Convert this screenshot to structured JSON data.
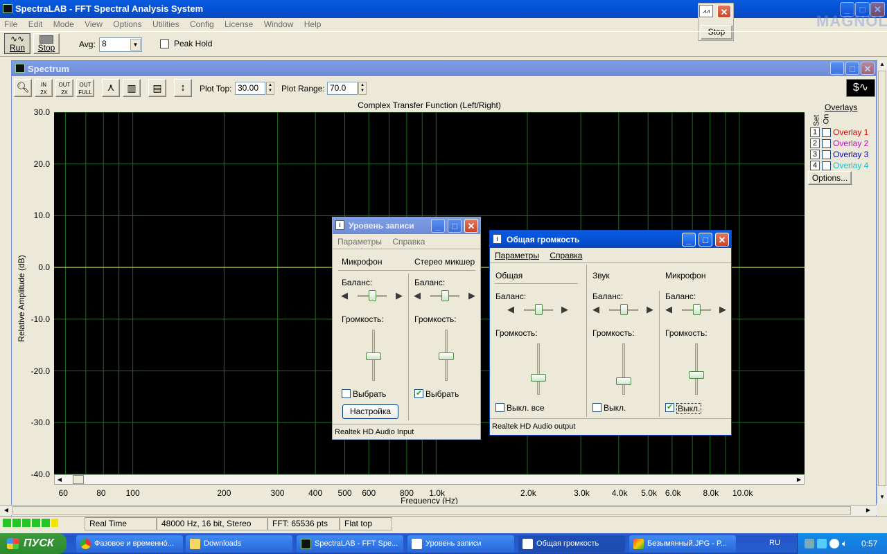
{
  "app": {
    "title": "SpectraLAB - FFT Spectral Analysis System",
    "menu": [
      "File",
      "Edit",
      "Mode",
      "View",
      "Options",
      "Utilities",
      "Config",
      "License",
      "Window",
      "Help"
    ]
  },
  "toolbar": {
    "run_label": "Run",
    "stop_label": "Stop",
    "avg_label": "Avg:",
    "avg_value": "8",
    "peak_hold_label": "Peak Hold"
  },
  "mini": {
    "stop_label": "Stop"
  },
  "watermark": "MAGNOLIA",
  "spectrum": {
    "title": "Spectrum",
    "plot_top_label": "Plot Top:",
    "plot_top_value": "30.00",
    "plot_range_label": "Plot Range:",
    "plot_range_value": "70.0",
    "chart_title": "Complex Transfer Function (Left/Right)",
    "y_axis_label": "Relative Amplitude (dB)",
    "x_axis_label": "Frequency (Hz)",
    "y_ticks": [
      "30.0",
      "20.0",
      "10.0",
      "0.0",
      "-10.0",
      "-20.0",
      "-30.0",
      "-40.0"
    ],
    "x_ticks": [
      "60",
      "80",
      "100",
      "200",
      "300",
      "400",
      "500",
      "600",
      "800",
      "1.0k",
      "2.0k",
      "3.0k",
      "4.0k",
      "5.0k",
      "6.0k",
      "8.0k",
      "10.0k"
    ]
  },
  "overlays": {
    "title": "Overlays",
    "set_label": "Set",
    "on_label": "On",
    "items": [
      {
        "num": "1",
        "label": "Overlay 1",
        "color": "#e00000"
      },
      {
        "num": "2",
        "label": "Overlay 2",
        "color": "#d000d0"
      },
      {
        "num": "3",
        "label": "Overlay 3",
        "color": "#0000d0"
      },
      {
        "num": "4",
        "label": "Overlay 4",
        "color": "#00c8d8"
      }
    ],
    "options_label": "Options..."
  },
  "rec_window": {
    "title": "Уровень записи",
    "menu": [
      "Параметры",
      "Справка"
    ],
    "col1": {
      "name": "Микрофон",
      "balance": "Баланс:",
      "volume": "Громкость:",
      "check": "Выбрать",
      "checked": false,
      "button": "Настройка"
    },
    "col2": {
      "name": "Стерео микшер",
      "balance": "Баланс:",
      "volume": "Громкость:",
      "check": "Выбрать",
      "checked": true
    },
    "status": "Realtek HD Audio Input"
  },
  "vol_window": {
    "title": "Общая громкость",
    "menu": [
      "Параметры",
      "Справка"
    ],
    "col1": {
      "name": "Общая",
      "balance": "Баланс:",
      "volume": "Громкость:",
      "check": "Выкл. все",
      "checked": false
    },
    "col2": {
      "name": "Звук",
      "balance": "Баланс:",
      "volume": "Громкость:",
      "check": "Выкл.",
      "checked": false
    },
    "col3": {
      "name": "Микрофон",
      "balance": "Баланс:",
      "volume": "Громкость:",
      "check": "Выкл.",
      "checked": true
    },
    "status": "Realtek HD Audio output"
  },
  "statusbar": {
    "mode": "Real Time",
    "format": "48000 Hz, 16 bit, Stereo",
    "fft": "FFT: 65536 pts",
    "window": "Flat top"
  },
  "taskbar": {
    "start": "ПУСК",
    "tasks": [
      "Фазовое и временнó...",
      "Downloads",
      "SpectraLAB - FFT Spe...",
      "Уровень записи",
      "Общая громкость",
      "Безымянный.JPG - P..."
    ],
    "lang": "RU",
    "clock": "0:57"
  }
}
